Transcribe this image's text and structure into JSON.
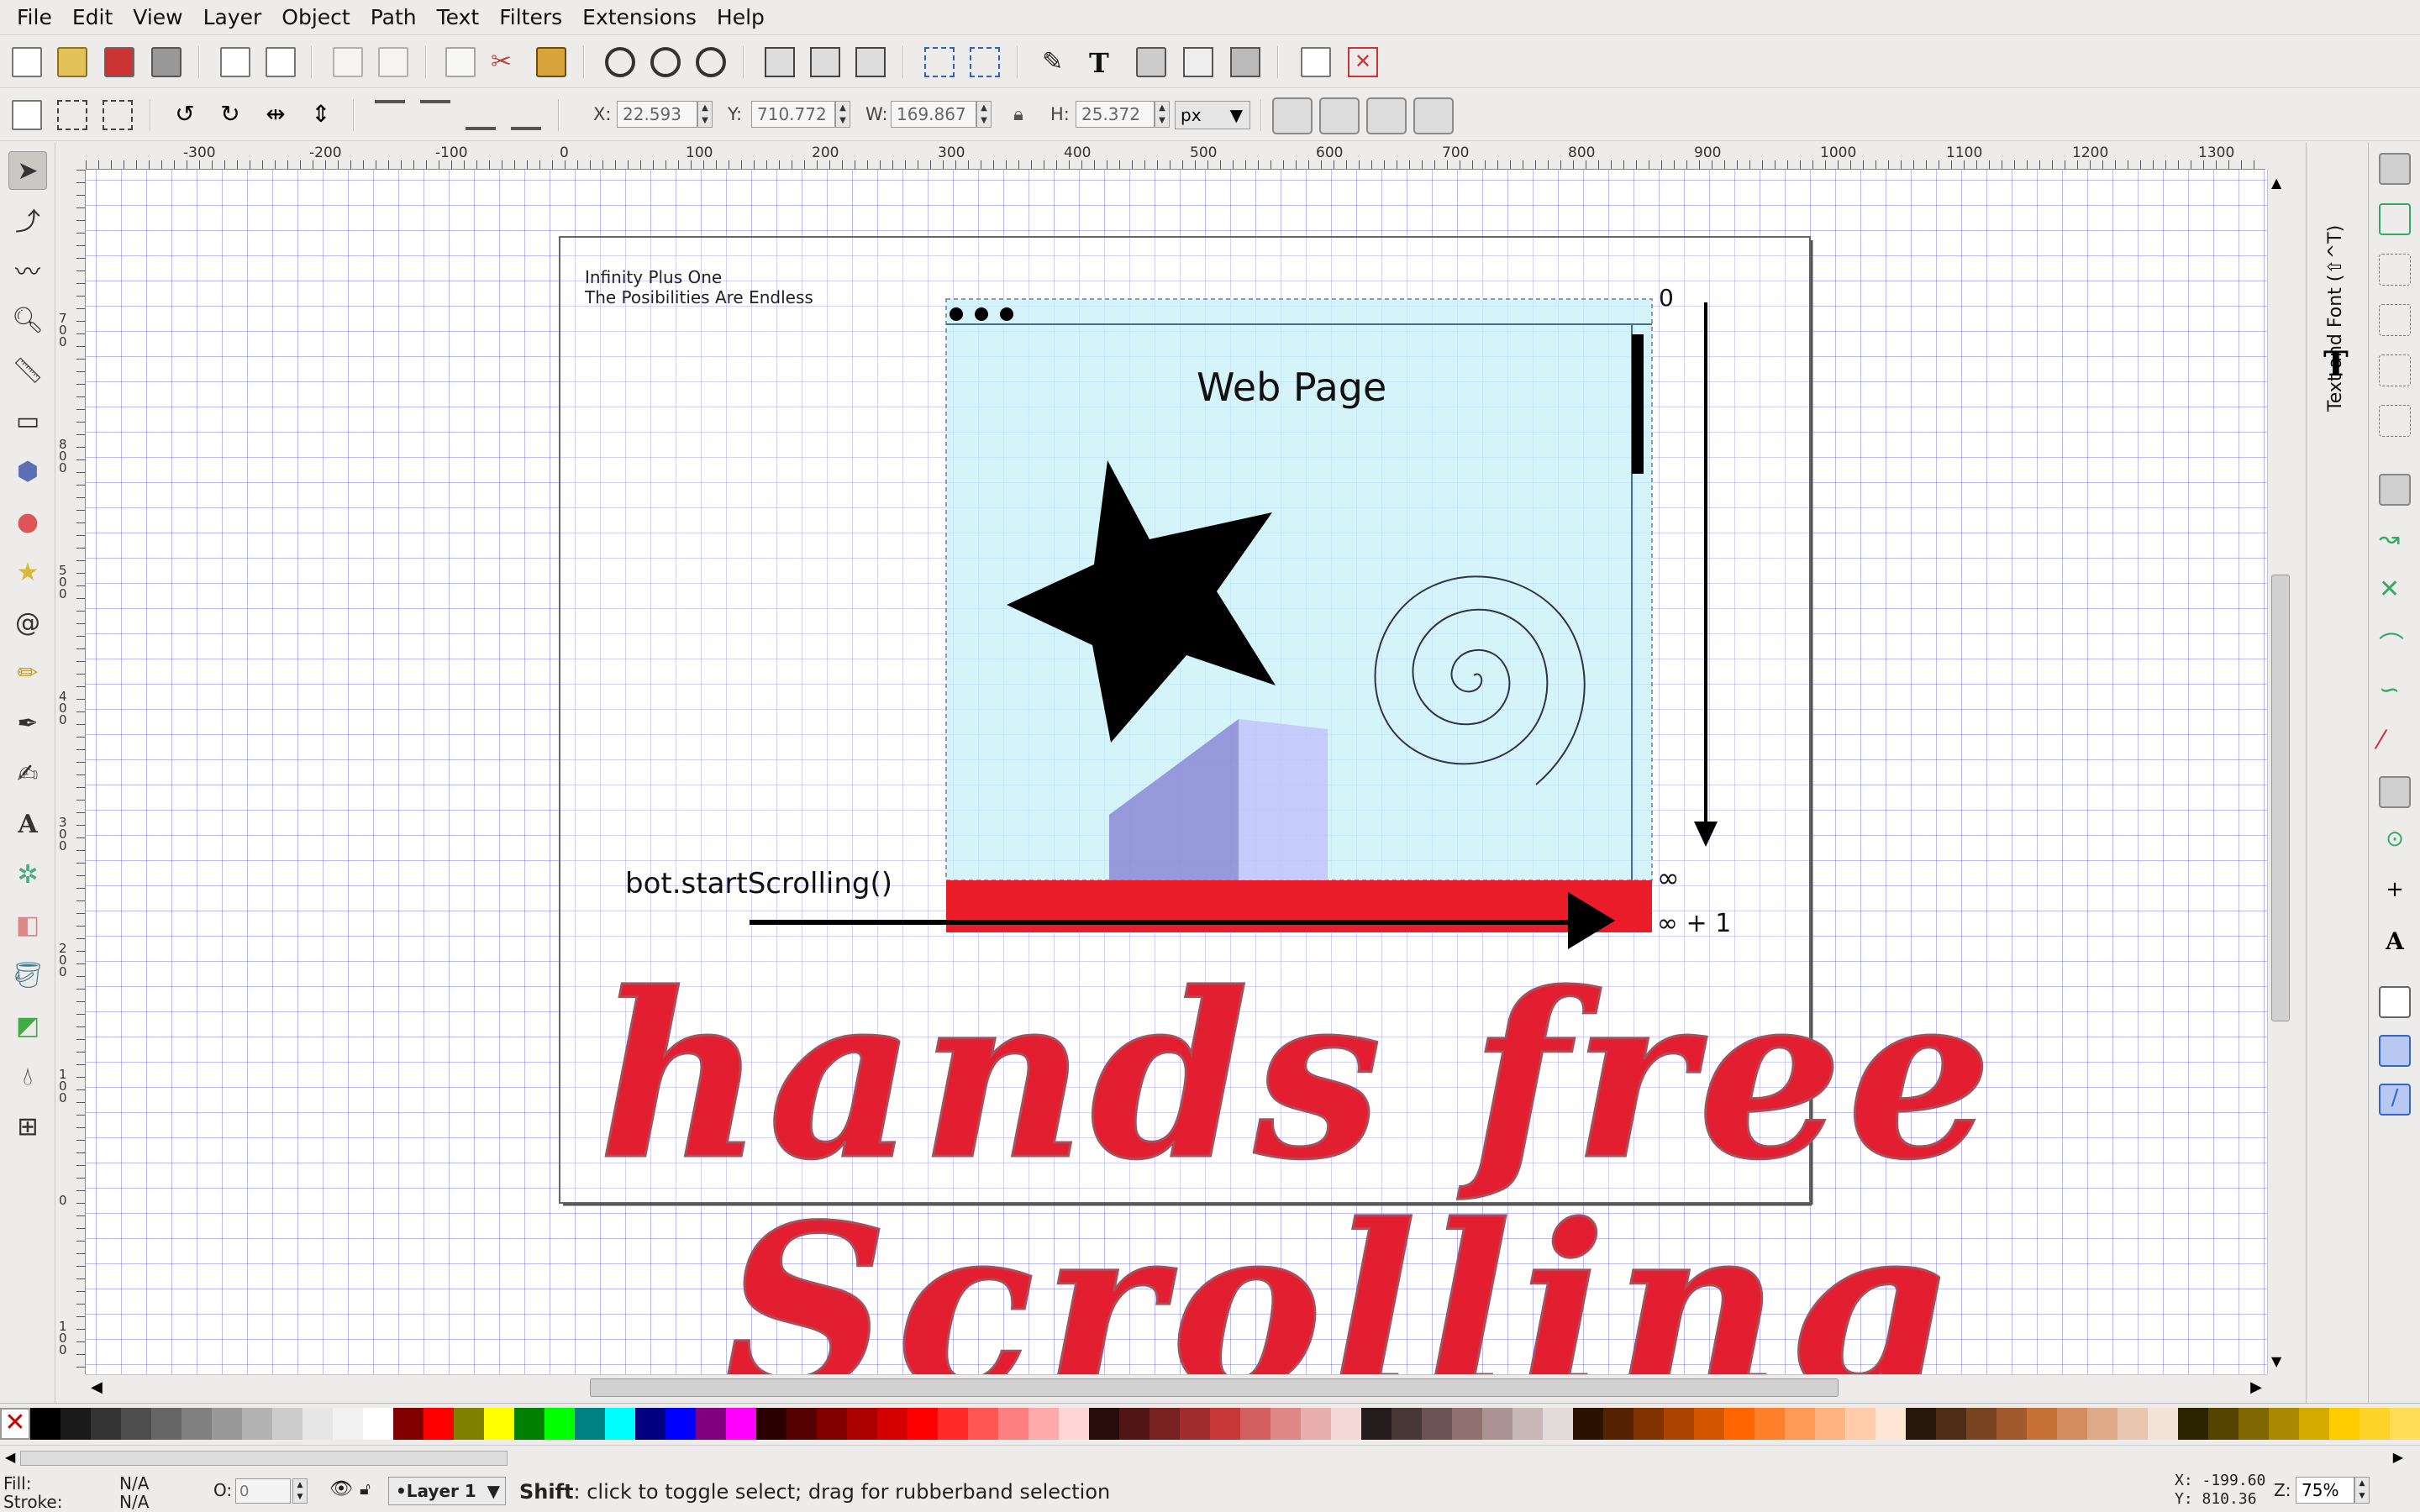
{
  "menu": [
    "File",
    "Edit",
    "View",
    "Layer",
    "Object",
    "Path",
    "Text",
    "Filters",
    "Extensions",
    "Help"
  ],
  "controls": {
    "x_label": "X:",
    "x_value": "22.593",
    "y_label": "Y:",
    "y_value": "710.772",
    "w_label": "W:",
    "w_value": "169.867",
    "h_label": "H:",
    "h_value": "25.372",
    "unit": "px"
  },
  "ruler_h": [
    "-300",
    "-200",
    "-100",
    "0",
    "100",
    "200",
    "300",
    "400",
    "500",
    "600",
    "700",
    "800",
    "900",
    "1000",
    "1100",
    "1200",
    "1300"
  ],
  "ruler_v": [
    "7 0 0",
    "8 0 0",
    "5 0 0",
    "4 0 0",
    "3 0 0",
    "2 0 0",
    "1 0 0",
    "0",
    "1 0 0"
  ],
  "document": {
    "title_line1": "Infinity Plus One",
    "title_line2": "The Posibilities Are Endless",
    "webpage_label": "Web Page",
    "scroll_zero": "0",
    "infinity": "∞",
    "infinity_plus_one": "∞ + 1",
    "bot_call": "bot.startScrolling()",
    "headline1": "hands free",
    "headline2": "Scrolling"
  },
  "dock_tab": "Text and Font (⇧^T)",
  "status": {
    "fill_label": "Fill:",
    "fill_value": "N/A",
    "stroke_label": "Stroke:",
    "stroke_value": "N/A",
    "opacity_label": "O:",
    "opacity_value": "0",
    "layer": "•Layer 1",
    "message_bold": "Shift",
    "message": ": click to toggle select; drag for rubberband selection",
    "x_readout": "X: -199.60",
    "y_readout": "Y:  810.36",
    "zoom_label": "Z:",
    "zoom": "75%"
  },
  "colors": {
    "accent_red": "#ea1c2a",
    "page_blue": "#d3f4fa",
    "palette": [
      "#000000",
      "#1a1a1a",
      "#333333",
      "#4d4d4d",
      "#666666",
      "#808080",
      "#999999",
      "#b3b3b3",
      "#cccccc",
      "#e6e6e6",
      "#f2f2f2",
      "#ffffff",
      "#800000",
      "#ff0000",
      "#808000",
      "#ffff00",
      "#008000",
      "#00ff00",
      "#008080",
      "#00ffff",
      "#000080",
      "#0000ff",
      "#800080",
      "#ff00ff",
      "#2b0000",
      "#550000",
      "#800000",
      "#aa0000",
      "#d40000",
      "#ff0000",
      "#ff2a2a",
      "#ff5555",
      "#ff8080",
      "#ffaaaa",
      "#ffd5d5",
      "#280b0b",
      "#501616",
      "#782121",
      "#a02c2c",
      "#c83737",
      "#d35f5f",
      "#de8787",
      "#e9afaf",
      "#f4d7d7",
      "#241c1c",
      "#483737",
      "#6c5353",
      "#917070",
      "#ac9393",
      "#c8b7b7",
      "#e3dbdb",
      "#2b1100",
      "#552200",
      "#803300",
      "#aa4400",
      "#d45500",
      "#ff6600",
      "#ff7f2a",
      "#ff9955",
      "#ffb380",
      "#ffccaa",
      "#ffe6d5",
      "#28170b",
      "#502d16",
      "#784421",
      "#a05a2c",
      "#c87137",
      "#d38d5f",
      "#deaa87",
      "#e9c6af",
      "#f4e3d7",
      "#2b2200",
      "#554400",
      "#806600",
      "#aa8800",
      "#d4aa00",
      "#ffcc00",
      "#ffd42a",
      "#ffdd55"
    ]
  }
}
